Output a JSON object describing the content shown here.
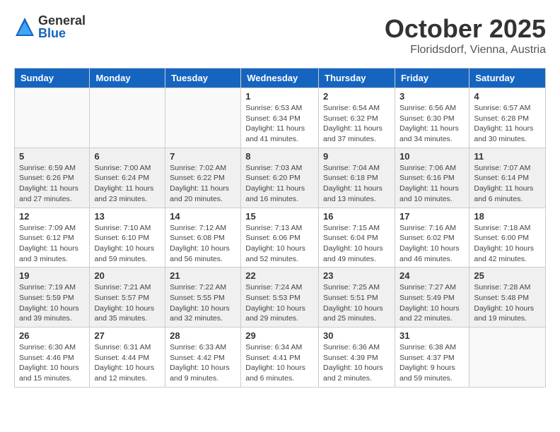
{
  "logo": {
    "general": "General",
    "blue": "Blue"
  },
  "header": {
    "month": "October 2025",
    "location": "Floridsdorf, Vienna, Austria"
  },
  "days_of_week": [
    "Sunday",
    "Monday",
    "Tuesday",
    "Wednesday",
    "Thursday",
    "Friday",
    "Saturday"
  ],
  "weeks": [
    {
      "shaded": false,
      "days": [
        {
          "num": "",
          "info": ""
        },
        {
          "num": "",
          "info": ""
        },
        {
          "num": "",
          "info": ""
        },
        {
          "num": "1",
          "info": "Sunrise: 6:53 AM\nSunset: 6:34 PM\nDaylight: 11 hours\nand 41 minutes."
        },
        {
          "num": "2",
          "info": "Sunrise: 6:54 AM\nSunset: 6:32 PM\nDaylight: 11 hours\nand 37 minutes."
        },
        {
          "num": "3",
          "info": "Sunrise: 6:56 AM\nSunset: 6:30 PM\nDaylight: 11 hours\nand 34 minutes."
        },
        {
          "num": "4",
          "info": "Sunrise: 6:57 AM\nSunset: 6:28 PM\nDaylight: 11 hours\nand 30 minutes."
        }
      ]
    },
    {
      "shaded": true,
      "days": [
        {
          "num": "5",
          "info": "Sunrise: 6:59 AM\nSunset: 6:26 PM\nDaylight: 11 hours\nand 27 minutes."
        },
        {
          "num": "6",
          "info": "Sunrise: 7:00 AM\nSunset: 6:24 PM\nDaylight: 11 hours\nand 23 minutes."
        },
        {
          "num": "7",
          "info": "Sunrise: 7:02 AM\nSunset: 6:22 PM\nDaylight: 11 hours\nand 20 minutes."
        },
        {
          "num": "8",
          "info": "Sunrise: 7:03 AM\nSunset: 6:20 PM\nDaylight: 11 hours\nand 16 minutes."
        },
        {
          "num": "9",
          "info": "Sunrise: 7:04 AM\nSunset: 6:18 PM\nDaylight: 11 hours\nand 13 minutes."
        },
        {
          "num": "10",
          "info": "Sunrise: 7:06 AM\nSunset: 6:16 PM\nDaylight: 11 hours\nand 10 minutes."
        },
        {
          "num": "11",
          "info": "Sunrise: 7:07 AM\nSunset: 6:14 PM\nDaylight: 11 hours\nand 6 minutes."
        }
      ]
    },
    {
      "shaded": false,
      "days": [
        {
          "num": "12",
          "info": "Sunrise: 7:09 AM\nSunset: 6:12 PM\nDaylight: 11 hours\nand 3 minutes."
        },
        {
          "num": "13",
          "info": "Sunrise: 7:10 AM\nSunset: 6:10 PM\nDaylight: 10 hours\nand 59 minutes."
        },
        {
          "num": "14",
          "info": "Sunrise: 7:12 AM\nSunset: 6:08 PM\nDaylight: 10 hours\nand 56 minutes."
        },
        {
          "num": "15",
          "info": "Sunrise: 7:13 AM\nSunset: 6:06 PM\nDaylight: 10 hours\nand 52 minutes."
        },
        {
          "num": "16",
          "info": "Sunrise: 7:15 AM\nSunset: 6:04 PM\nDaylight: 10 hours\nand 49 minutes."
        },
        {
          "num": "17",
          "info": "Sunrise: 7:16 AM\nSunset: 6:02 PM\nDaylight: 10 hours\nand 46 minutes."
        },
        {
          "num": "18",
          "info": "Sunrise: 7:18 AM\nSunset: 6:00 PM\nDaylight: 10 hours\nand 42 minutes."
        }
      ]
    },
    {
      "shaded": true,
      "days": [
        {
          "num": "19",
          "info": "Sunrise: 7:19 AM\nSunset: 5:59 PM\nDaylight: 10 hours\nand 39 minutes."
        },
        {
          "num": "20",
          "info": "Sunrise: 7:21 AM\nSunset: 5:57 PM\nDaylight: 10 hours\nand 35 minutes."
        },
        {
          "num": "21",
          "info": "Sunrise: 7:22 AM\nSunset: 5:55 PM\nDaylight: 10 hours\nand 32 minutes."
        },
        {
          "num": "22",
          "info": "Sunrise: 7:24 AM\nSunset: 5:53 PM\nDaylight: 10 hours\nand 29 minutes."
        },
        {
          "num": "23",
          "info": "Sunrise: 7:25 AM\nSunset: 5:51 PM\nDaylight: 10 hours\nand 25 minutes."
        },
        {
          "num": "24",
          "info": "Sunrise: 7:27 AM\nSunset: 5:49 PM\nDaylight: 10 hours\nand 22 minutes."
        },
        {
          "num": "25",
          "info": "Sunrise: 7:28 AM\nSunset: 5:48 PM\nDaylight: 10 hours\nand 19 minutes."
        }
      ]
    },
    {
      "shaded": false,
      "days": [
        {
          "num": "26",
          "info": "Sunrise: 6:30 AM\nSunset: 4:46 PM\nDaylight: 10 hours\nand 15 minutes."
        },
        {
          "num": "27",
          "info": "Sunrise: 6:31 AM\nSunset: 4:44 PM\nDaylight: 10 hours\nand 12 minutes."
        },
        {
          "num": "28",
          "info": "Sunrise: 6:33 AM\nSunset: 4:42 PM\nDaylight: 10 hours\nand 9 minutes."
        },
        {
          "num": "29",
          "info": "Sunrise: 6:34 AM\nSunset: 4:41 PM\nDaylight: 10 hours\nand 6 minutes."
        },
        {
          "num": "30",
          "info": "Sunrise: 6:36 AM\nSunset: 4:39 PM\nDaylight: 10 hours\nand 2 minutes."
        },
        {
          "num": "31",
          "info": "Sunrise: 6:38 AM\nSunset: 4:37 PM\nDaylight: 9 hours\nand 59 minutes."
        },
        {
          "num": "",
          "info": ""
        }
      ]
    }
  ]
}
